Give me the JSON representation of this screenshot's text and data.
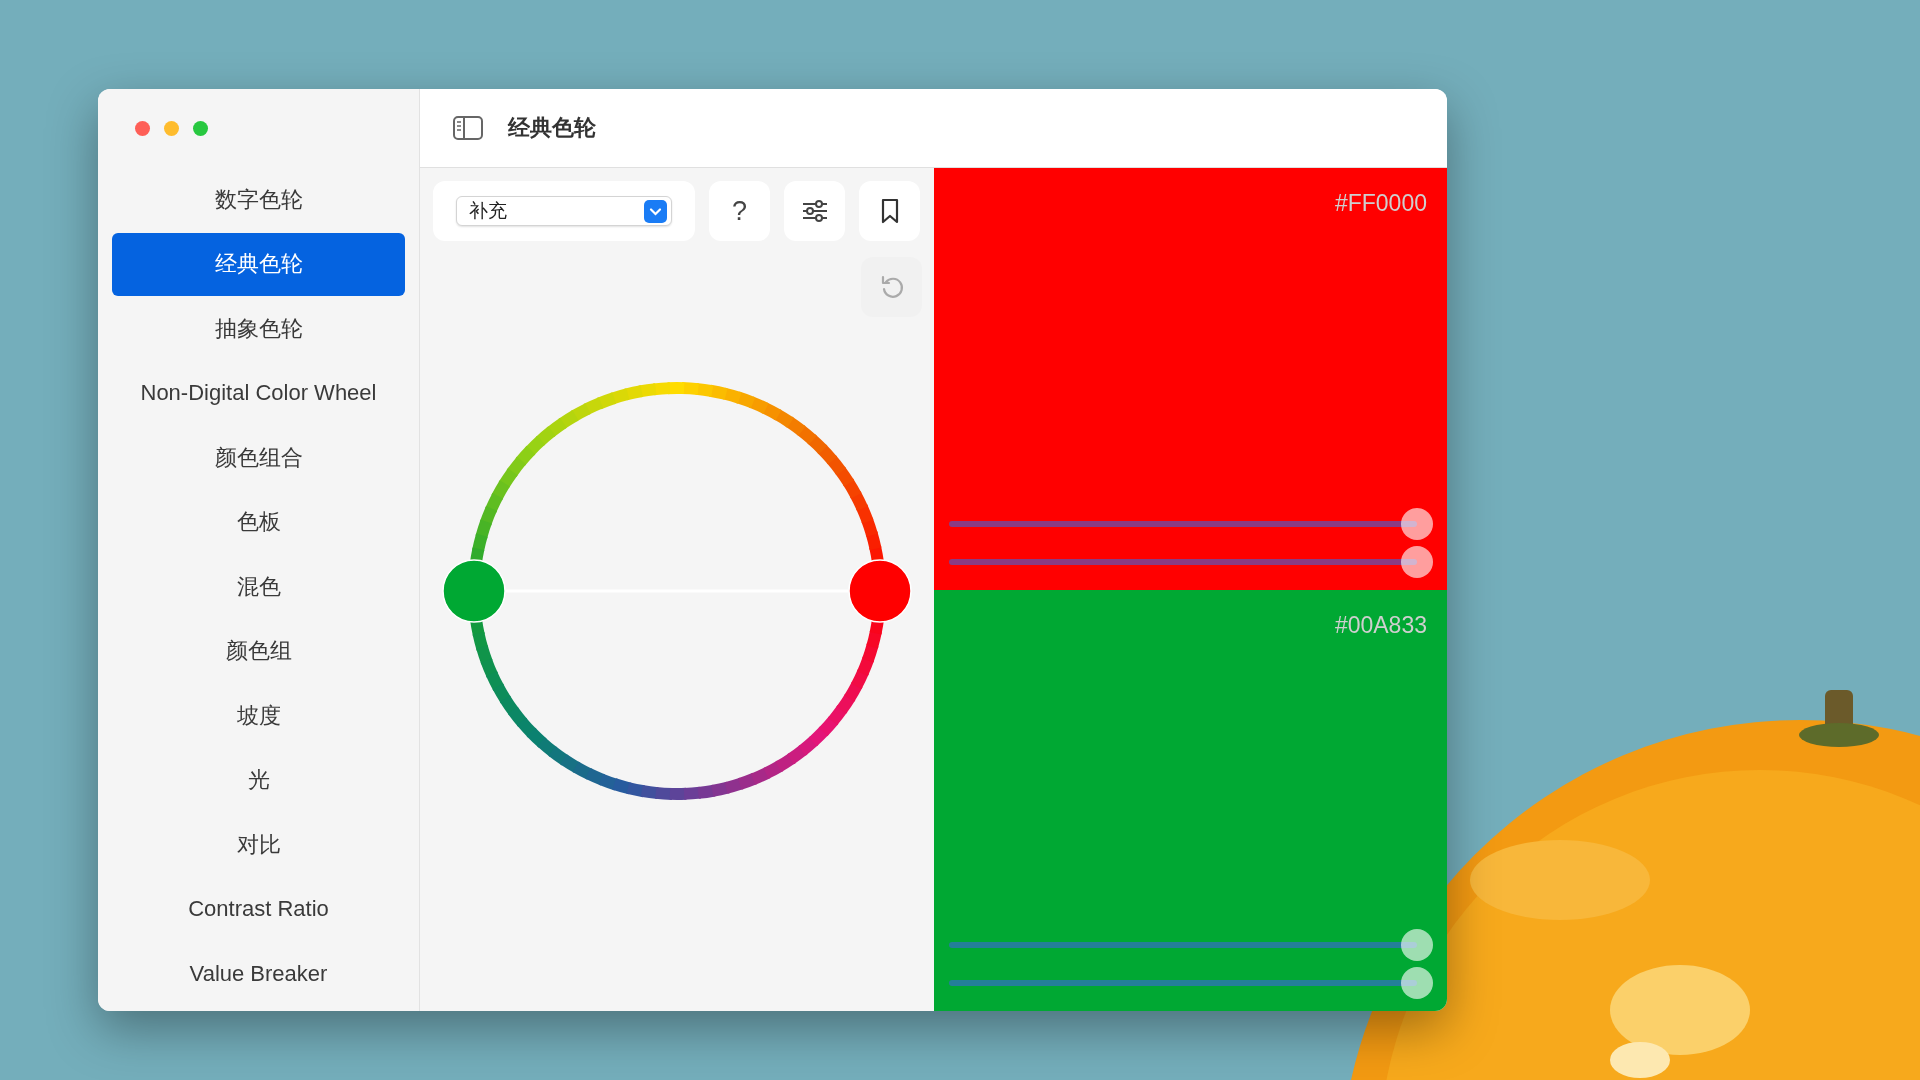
{
  "window": {
    "title": "经典色轮"
  },
  "sidebar": {
    "items": [
      {
        "label": "数字色轮",
        "selected": false
      },
      {
        "label": "经典色轮",
        "selected": true
      },
      {
        "label": "抽象色轮",
        "selected": false
      },
      {
        "label": "Non-Digital Color Wheel",
        "selected": false
      },
      {
        "label": "颜色组合",
        "selected": false
      },
      {
        "label": "色板",
        "selected": false
      },
      {
        "label": "混色",
        "selected": false
      },
      {
        "label": "颜色组",
        "selected": false
      },
      {
        "label": "坡度",
        "selected": false
      },
      {
        "label": "光",
        "selected": false
      },
      {
        "label": "对比",
        "selected": false
      },
      {
        "label": "Contrast Ratio",
        "selected": false
      },
      {
        "label": "Value Breaker",
        "selected": false
      }
    ]
  },
  "toolbar": {
    "scheme_select": {
      "value": "补充"
    },
    "help_button": {
      "label": "?"
    }
  },
  "swatches": [
    {
      "hex": "#FF0000",
      "color": "#ff0000",
      "sliders": [
        {
          "level": 1
        },
        {
          "level": 1
        }
      ]
    },
    {
      "hex": "#00A833",
      "color": "#00a833",
      "sliders": [
        {
          "level": 1
        },
        {
          "level": 1
        }
      ]
    }
  ]
}
